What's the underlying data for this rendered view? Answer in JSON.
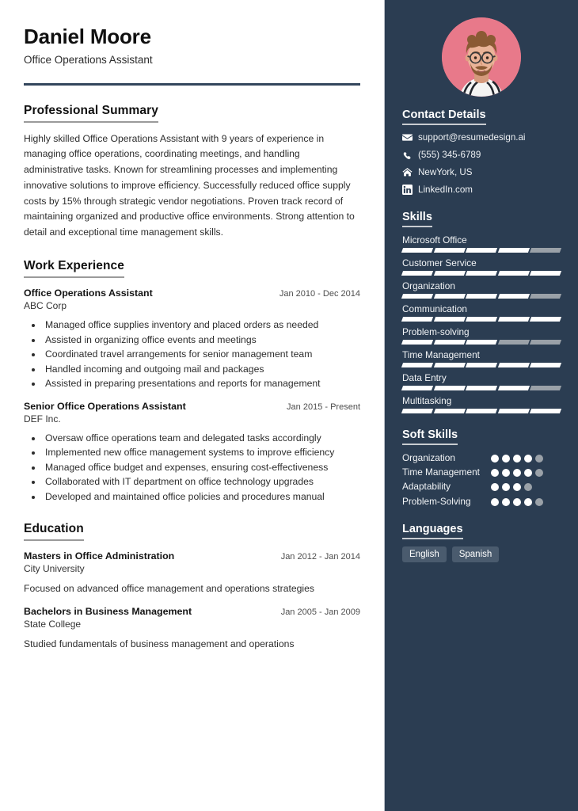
{
  "header": {
    "name": "Daniel Moore",
    "job_title": "Office Operations Assistant"
  },
  "colors": {
    "sidebar_bg": "#2b3d52",
    "rule": "#33465c",
    "photo_bg": "#e8798a",
    "bar_on": "#ffffff",
    "bar_off": "#9aa1a8",
    "chip_bg": "#4a5b6e"
  },
  "summary": {
    "title": "Professional Summary",
    "text": "Highly skilled Office Operations Assistant with 9 years of experience in managing office operations, coordinating meetings, and handling administrative tasks. Known for streamlining processes and implementing innovative solutions to improve efficiency. Successfully reduced office supply costs by 15% through strategic vendor negotiations. Proven track record of maintaining organized and productive office environments. Strong attention to detail and exceptional time management skills."
  },
  "work": {
    "title": "Work Experience",
    "entries": [
      {
        "role": "Office Operations Assistant",
        "date": "Jan 2010 - Dec 2014",
        "org": "ABC Corp",
        "bullets": [
          "Managed office supplies inventory and placed orders as needed",
          "Assisted in organizing office events and meetings",
          "Coordinated travel arrangements for senior management team",
          "Handled incoming and outgoing mail and packages",
          "Assisted in preparing presentations and reports for management"
        ]
      },
      {
        "role": "Senior Office Operations Assistant",
        "date": "Jan 2015 - Present",
        "org": "DEF Inc.",
        "bullets": [
          "Oversaw office operations team and delegated tasks accordingly",
          "Implemented new office management systems to improve efficiency",
          "Managed office budget and expenses, ensuring cost-effectiveness",
          "Collaborated with IT department on office technology upgrades",
          "Developed and maintained office policies and procedures manual"
        ]
      }
    ]
  },
  "education": {
    "title": "Education",
    "entries": [
      {
        "degree": "Masters in Office Administration",
        "date": "Jan 2012 - Jan 2014",
        "school": "City University",
        "desc": "Focused on advanced office management and operations strategies"
      },
      {
        "degree": "Bachelors in Business Management",
        "date": "Jan 2005 - Jan 2009",
        "school": "State College",
        "desc": "Studied fundamentals of business management and operations"
      }
    ]
  },
  "contact": {
    "title": "Contact Details",
    "items": [
      {
        "icon": "envelope-icon",
        "value": "support@resumedesign.ai"
      },
      {
        "icon": "phone-icon",
        "value": "(555) 345-6789"
      },
      {
        "icon": "home-icon",
        "value": "NewYork, US"
      },
      {
        "icon": "linkedin-icon",
        "value": "LinkedIn.com"
      }
    ]
  },
  "skills": {
    "title": "Skills",
    "max": 5,
    "items": [
      {
        "label": "Microsoft Office",
        "level": 4
      },
      {
        "label": "Customer Service",
        "level": 5
      },
      {
        "label": "Organization",
        "level": 4
      },
      {
        "label": "Communication",
        "level": 5
      },
      {
        "label": "Problem-solving",
        "level": 3
      },
      {
        "label": "Time Management",
        "level": 5
      },
      {
        "label": "Data Entry",
        "level": 4
      },
      {
        "label": "Multitasking",
        "level": 5
      }
    ]
  },
  "soft_skills": {
    "title": "Soft Skills",
    "max": 5,
    "items": [
      {
        "label": "Organization",
        "level": 4
      },
      {
        "label": "Time Management",
        "level": 4
      },
      {
        "label": "Adaptability",
        "level": 3
      },
      {
        "label": "Problem-Solving",
        "level": 4
      }
    ]
  },
  "languages": {
    "title": "Languages",
    "items": [
      "English",
      "Spanish"
    ]
  },
  "photo": {
    "alt": "profile-photo"
  }
}
